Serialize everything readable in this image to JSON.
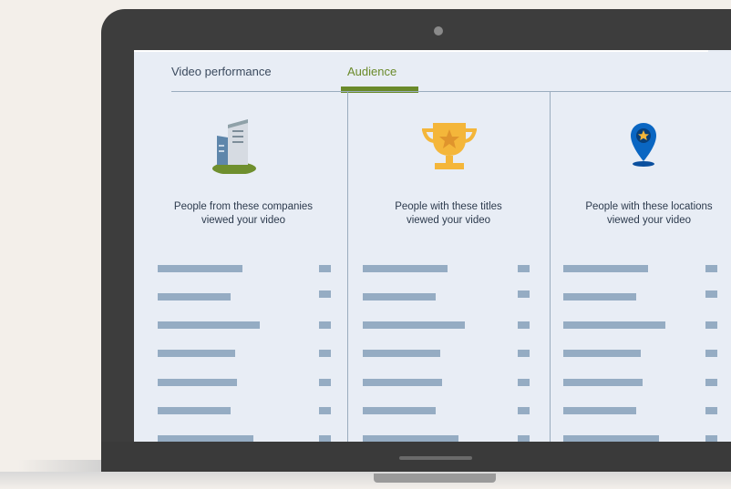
{
  "tabs": [
    {
      "label": "Video performance",
      "active": false
    },
    {
      "label": "Audience",
      "active": true
    }
  ],
  "colors": {
    "accent": "#6a8a2a",
    "bar": "#95acc3",
    "screen_bg": "#e8edf5",
    "bezel": "#3d3d3d"
  },
  "columns": [
    {
      "icon": "building-icon",
      "title_line1": "People from these companies",
      "title_line2": "viewed your video"
    },
    {
      "icon": "trophy-icon",
      "title_line1": "People with these titles",
      "title_line2": "viewed your video"
    },
    {
      "icon": "location-pin-icon",
      "title_line1": "People with these locations",
      "title_line2": "viewed your video"
    }
  ]
}
